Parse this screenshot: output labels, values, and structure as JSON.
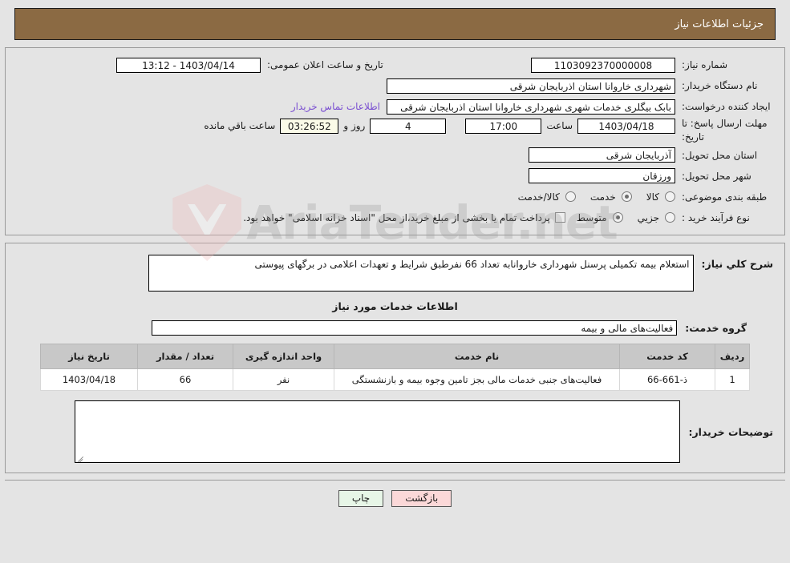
{
  "header": {
    "title": "جزئیات اطلاعات نیاز"
  },
  "form": {
    "need_number_label": "شماره نیاز:",
    "need_number_value": "1103092370000008",
    "public_announce_label": "تاریخ و ساعت اعلان عمومی:",
    "public_announce_value": "1403/04/14 - 13:12",
    "buyer_org_label": "نام دستگاه خریدار:",
    "buyer_org_value": "شهرداری خاروانا استان اذربایجان شرقی",
    "creator_label": "ایجاد کننده درخواست:",
    "creator_value": "بابک بیگلری خدمات شهری شهرداری خاروانا استان اذربایجان شرقی",
    "contact_link": "اطلاعات تماس خریدار",
    "deadline_label": "مهلت ارسال پاسخ: تا تاریخ:",
    "deadline_date": "1403/04/18",
    "hour_label": "ساعت",
    "deadline_time": "17:00",
    "days_value": "4",
    "days_label": "روز و",
    "countdown_value": "03:26:52",
    "countdown_label": "ساعت باقي مانده",
    "province_label": "استان محل تحویل:",
    "province_value": "آذربایجان شرقی",
    "city_label": "شهر محل تحویل:",
    "city_value": "ورزقان",
    "category_label": "طبقه بندی موضوعی:",
    "category_options": [
      {
        "label": "کالا",
        "selected": false
      },
      {
        "label": "خدمت",
        "selected": true
      },
      {
        "label": "کالا/خدمت",
        "selected": false
      }
    ],
    "process_label": "نوع فرآیند خرید :",
    "process_options": [
      {
        "label": "جزیي",
        "selected": false
      },
      {
        "label": "متوسط",
        "selected": true
      }
    ],
    "treasury_checkbox_label": "پرداخت تمام یا بخشی از مبلغ خرید،از محل \"اسناد خزانه اسلامی\" خواهد بود.",
    "treasury_checked": false
  },
  "description": {
    "label": "شرح کلي نیاز:",
    "value": "استعلام بیمه تکمیلی پرسنل شهرداری  خاروانابه تعداد 66 نفرطبق شرایط  و تعهدات اعلامی در برگهای پیوستی"
  },
  "services": {
    "section_title": "اطلاعات خدمات مورد نیاز",
    "group_label": "گروه خدمت:",
    "group_value": "فعالیت‌های مالی و بیمه",
    "table": {
      "columns": [
        "ردیف",
        "کد خدمت",
        "نام خدمت",
        "واحد اندازه گیری",
        "تعداد / مقدار",
        "تاریخ نیاز"
      ],
      "rows": [
        {
          "index": "1",
          "code": "ذ-661-66",
          "name": "فعالیت‌های جنبی خدمات مالی بجز تامین وجوه بیمه و بازنشستگی",
          "unit": "نفر",
          "quantity": "66",
          "need_date": "1403/04/18"
        }
      ]
    }
  },
  "buyer_notes": {
    "label": "توضیحات خریدار:",
    "value": ""
  },
  "footer": {
    "print_label": "چاپ",
    "back_label": "بازگشت"
  },
  "watermark": {
    "text": "AriaTender.net"
  },
  "colors": {
    "header_bg": "#8b6a43",
    "page_bg": "#e4e4e4",
    "link": "#7a4fd1",
    "countdown_bg": "#fbfbe8",
    "print_bg": "#e7f6e7",
    "back_bg": "#fbd8d8",
    "table_header_bg": "#c8c8c8"
  }
}
